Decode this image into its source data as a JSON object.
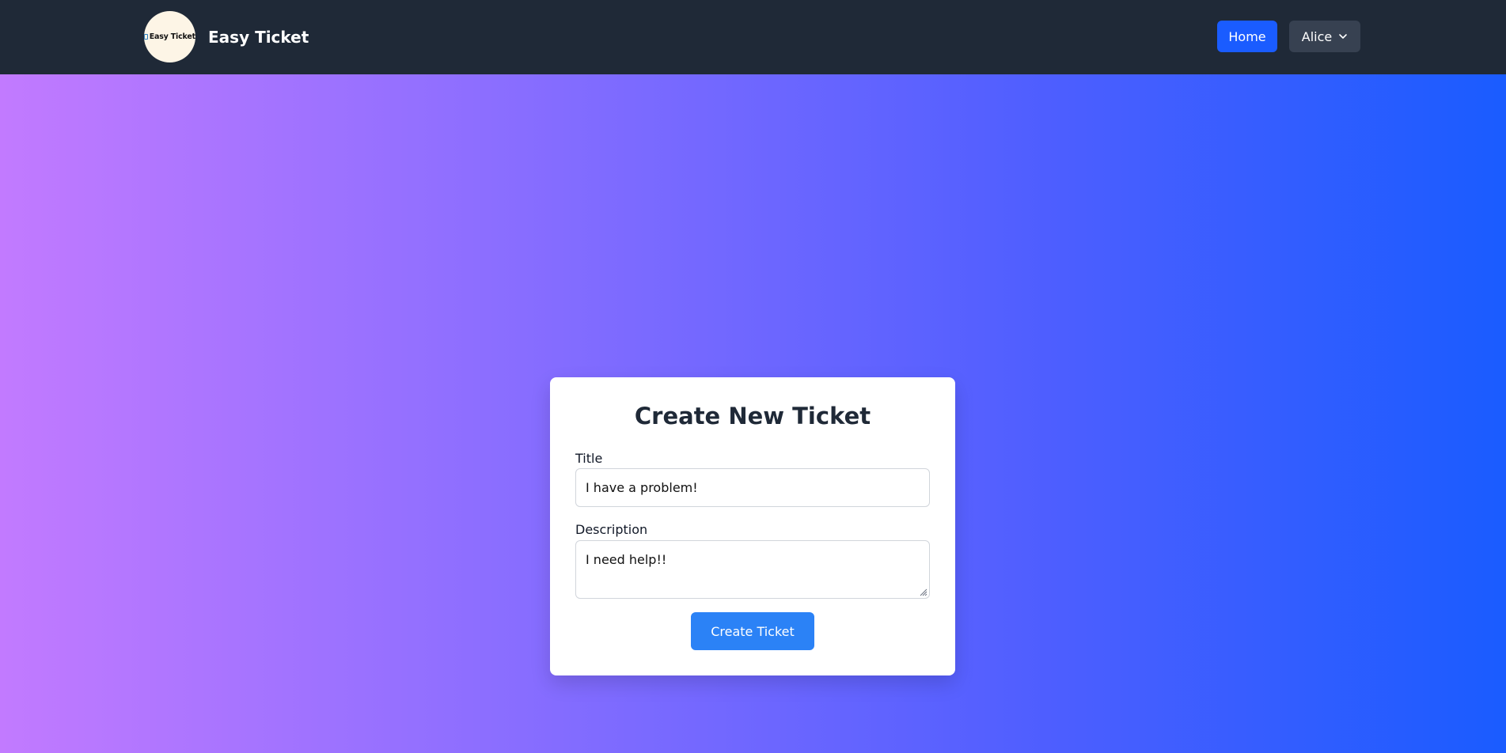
{
  "nav": {
    "brand_name": "Easy Ticket",
    "logo_text": "Easy Ticket",
    "home_label": "Home",
    "user_label": "Alice"
  },
  "form": {
    "heading": "Create New Ticket",
    "title_label": "Title",
    "title_value": "I have a problem!",
    "description_label": "Description",
    "description_value": "I need help!!",
    "submit_label": "Create Ticket"
  },
  "icons": {
    "logo": "ticket-logo-icon",
    "user_menu": "chevron-down-icon",
    "textarea_resize": "resize-handle-icon"
  },
  "colors": {
    "navbar_bg": "#1f2937",
    "primary": "#1a5cff",
    "submit_button": "#2b82f6",
    "user_button_bg": "#374151",
    "gradient_start": "#c27aff",
    "gradient_end": "#1a5cff",
    "card_bg": "#ffffff"
  }
}
